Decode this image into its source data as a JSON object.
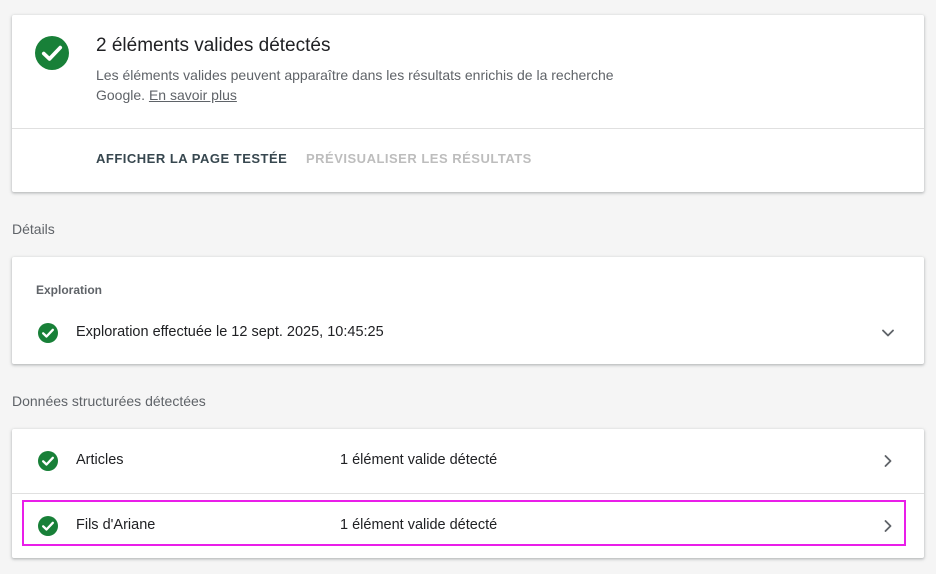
{
  "summary": {
    "title": "2 éléments valides détectés",
    "description": "Les éléments valides peuvent apparaître dans les résultats enrichis de la recherche Google.",
    "learn_more": "En savoir plus",
    "actions": {
      "view_tested_page": "AFFICHER LA PAGE TESTÉE",
      "preview_results": "PRÉVISUALISER LES RÉSULTATS"
    }
  },
  "details": {
    "section_label": "Détails",
    "exploration": {
      "heading": "Exploration",
      "status_text": "Exploration effectuée le 12 sept. 2025, 10:45:25"
    }
  },
  "structured_data": {
    "section_label": "Données structurées détectées",
    "rows": [
      {
        "name": "Articles",
        "status": "1 élément valide détecté"
      },
      {
        "name": "Fils d'Ariane",
        "status": "1 élément valide détecté"
      }
    ]
  },
  "colors": {
    "success_green": "#188038",
    "highlight": "#e91ee9",
    "disabled_text": "#bdbdbd"
  },
  "icons": {
    "valid": "check-circle-icon",
    "expand": "chevron-down-icon",
    "open": "chevron-right-icon"
  }
}
